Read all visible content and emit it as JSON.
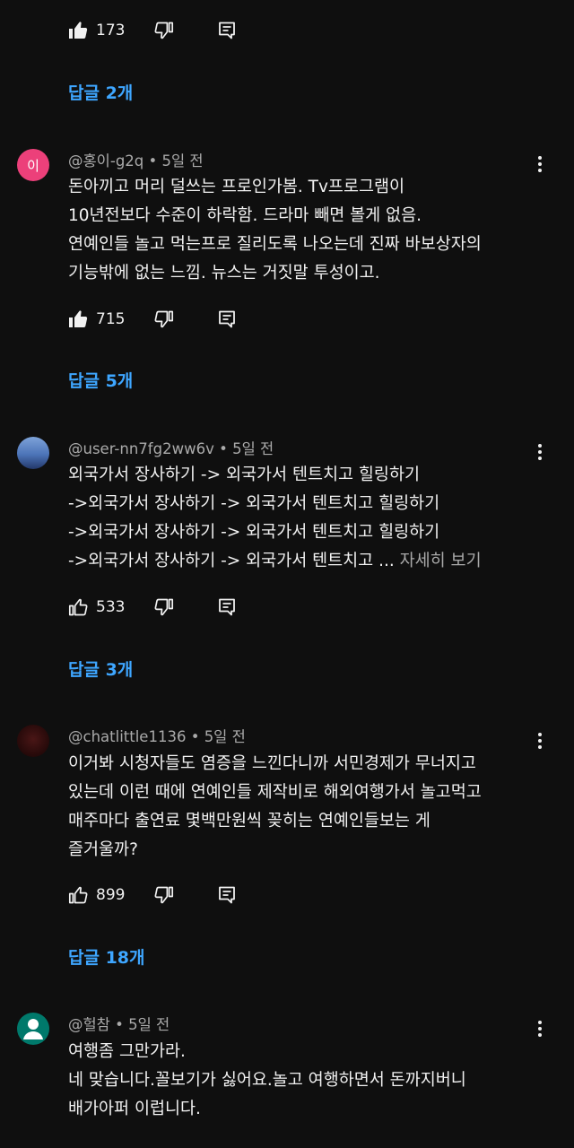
{
  "colors": {
    "background": "#0f0f0f",
    "link": "#3ea6ff",
    "meta": "#aaaaaa",
    "text": "#f1f1f1",
    "avatar_pink": "#ec407a",
    "avatar_teal": "#00796b"
  },
  "top": {
    "like_count": "173",
    "replies_label": "답글 2개"
  },
  "comments": [
    {
      "author": "@홍이-g2q",
      "sep": " • ",
      "time": "5일 전",
      "avatar_letter": "이",
      "lines": [
        "돈아끼고 머리 덜쓰는 프로인가봄. Tv프로그램이",
        "10년전보다 수준이 하락함. 드라마 빼면 볼게 없음.",
        "연예인들 놀고 먹는프로 질리도록 나오는데 진짜 바보상자의",
        "기능밖에 없는 느낌. 뉴스는 거짓말 투성이고."
      ],
      "like_count": "715",
      "replies_label": "답글 5개",
      "liked": true
    },
    {
      "author": "@user-nn7fg2ww6v",
      "sep": " • ",
      "time": "5일 전",
      "lines": [
        "외국가서 장사하기 -> 외국가서 텐트치고 힐링하기",
        "->외국가서 장사하기 -> 외국가서 텐트치고 힐링하기",
        "->외국가서 장사하기 -> 외국가서 텐트치고 힐링하기",
        "->외국가서 장사하기 -> 외국가서 텐트치고 ... "
      ],
      "read_more": "자세히 보기",
      "like_count": "533",
      "replies_label": "답글 3개",
      "liked": false
    },
    {
      "author": "@chatlittle1136",
      "sep": " • ",
      "time": "5일 전",
      "lines": [
        "이거봐 시청자들도 염증을 느낀다니까 서민경제가 무너지고",
        "있는데 이런 때에 연예인들 제작비로 해외여행가서 놀고먹고",
        "매주마다 출연료 몇백만원씩 꽂히는 연예인들보는 게",
        "즐거울까?"
      ],
      "like_count": "899",
      "replies_label": "답글 18개",
      "liked": false
    },
    {
      "author": "@헐참",
      "sep": " • ",
      "time": "5일 전",
      "lines": [
        "여행좀 그만가라.",
        "네 맞습니다.꼴보기가 싫어요.놀고 여행하면서 돈까지버니",
        "배가아퍼 이럽니다."
      ]
    }
  ],
  "icons": {
    "like": "thumbs-up-icon",
    "dislike": "thumbs-down-icon",
    "reply": "reply-icon",
    "more": "more-vert-icon",
    "default_avatar": "person-icon"
  }
}
